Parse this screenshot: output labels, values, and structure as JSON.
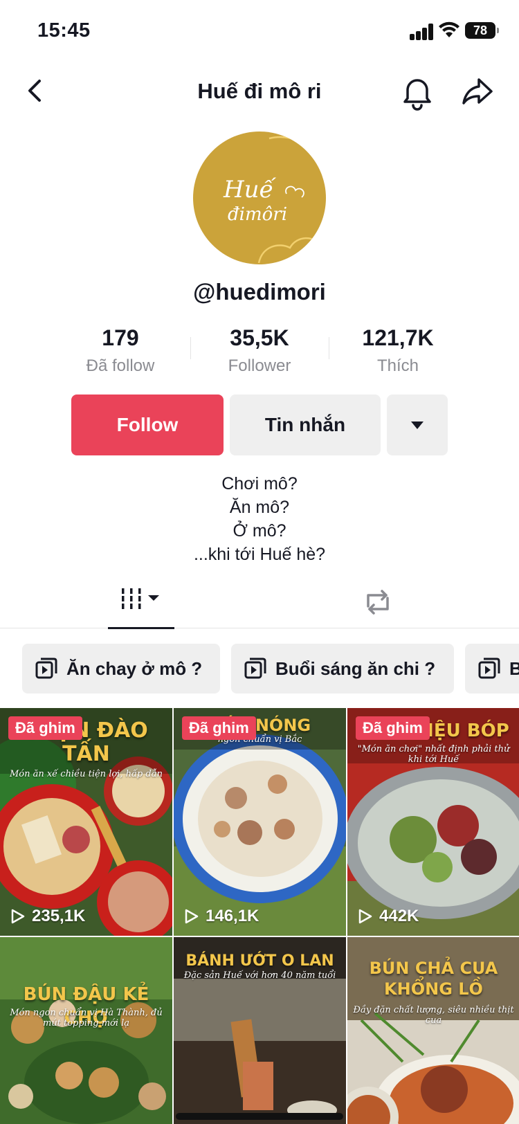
{
  "status_bar": {
    "time": "15:45",
    "battery": "78"
  },
  "header": {
    "title": "Huế đi mô ri"
  },
  "avatar": {
    "logo_text_line1": "Huế",
    "logo_text_line2": "đimôri"
  },
  "profile": {
    "username": "@huedimori"
  },
  "stats": [
    {
      "value": "179",
      "label": "Đã follow"
    },
    {
      "value": "35,5K",
      "label": "Follower"
    },
    {
      "value": "121,7K",
      "label": "Thích"
    }
  ],
  "actions": {
    "follow": "Follow",
    "message": "Tin nhắn"
  },
  "bio": [
    "Chơi mô?",
    "Ăn mô?",
    "Ở mô?",
    "...khi tới Huế hè?"
  ],
  "playlists": [
    {
      "label": "Ăn chay ở mô ?"
    },
    {
      "label": "Buổi sáng ăn chi ?"
    },
    {
      "label": "B"
    }
  ],
  "videos": [
    {
      "pinned": "Đã ghim",
      "views": "235,1K",
      "title": "TRỘN ĐÀO TẤN",
      "subtitle": "Món ăn xế chiều tiện lợi, hấp dẫn"
    },
    {
      "pinned": "Đã ghim",
      "views": "146,1K",
      "title": "ƯỚC NÓNG",
      "subtitle": "ngon chuẩn vị Bắc"
    },
    {
      "pinned": "Đã ghim",
      "views": "442K",
      "title": "GỎI TRIỆU BÓP",
      "subtitle": "\"Món ăn chơi\" nhất định phải thử khi tới Huế"
    },
    {
      "pinned": "",
      "views": "",
      "title": "BÚN ĐẬU KẺ CHỢ",
      "subtitle": "Món ngon chuẩn vị Hà Thành, đủ mút topping mới lạ"
    },
    {
      "pinned": "",
      "views": "",
      "title": "BÁNH ƯỚT O LAN",
      "subtitle": "Đặc sản Huế với hơn 40 năm tuổi"
    },
    {
      "pinned": "",
      "views": "",
      "title": "BÚN CHẢ CUA KHỔNG LỒ",
      "subtitle": "Đầy đặn chất lượng, siêu nhiều thịt cua"
    }
  ],
  "colors": {
    "accent": "#ea4359",
    "secondary_bg": "#efefef",
    "muted_text": "#8a8b91",
    "title_gold": "#f3c64b"
  }
}
